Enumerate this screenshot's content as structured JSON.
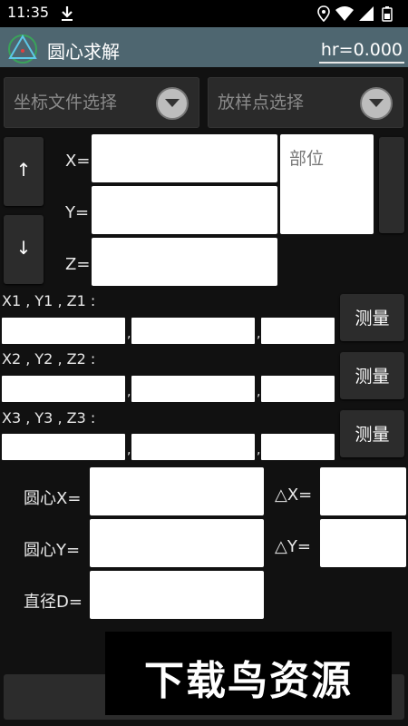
{
  "status_bar": {
    "time": "11:35",
    "icons": [
      "download-icon",
      "location-icon",
      "wifi-icon",
      "signal-icon",
      "battery-icon"
    ]
  },
  "app_bar": {
    "title": "圆心求解",
    "hr_value": "hr=0.000"
  },
  "spinners": {
    "coord_file": "坐标文件选择",
    "stakeout_point": "放样点选择"
  },
  "nav": {
    "up": "↑",
    "down": "↓"
  },
  "point": {
    "x_label": "X=",
    "y_label": "Y=",
    "z_label": "Z=",
    "part_placeholder": "部位"
  },
  "measurements": [
    {
      "label": "X1 , Y1 , Z1 :",
      "button": "测量"
    },
    {
      "label": "X2 , Y2 , Z2 :",
      "button": "测量"
    },
    {
      "label": "X3 , Y3 , Z3 :",
      "button": "测量"
    }
  ],
  "results": {
    "center_x": "圆心X=",
    "center_y": "圆心Y=",
    "diameter": "直径D=",
    "delta_x": "△X=",
    "delta_y": "△Y="
  },
  "watermark": "下载鸟资源",
  "colors": {
    "app_bar": "#4e6670",
    "background": "#111111",
    "button": "#2c2c2c"
  }
}
